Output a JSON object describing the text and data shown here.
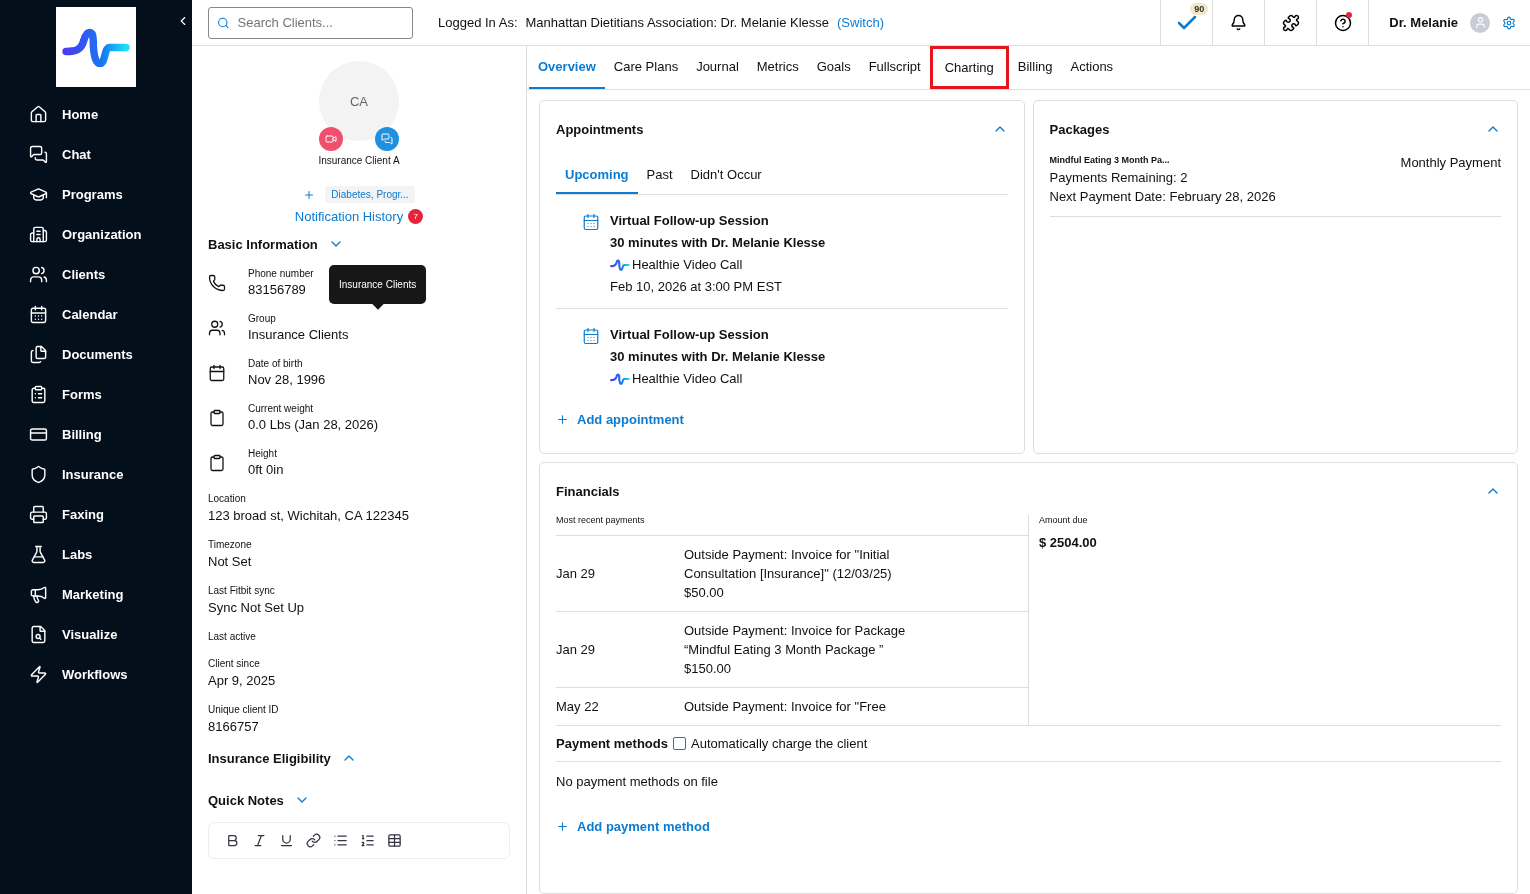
{
  "sidebar": {
    "items": [
      {
        "label": "Home"
      },
      {
        "label": "Chat"
      },
      {
        "label": "Programs"
      },
      {
        "label": "Organization"
      },
      {
        "label": "Clients"
      },
      {
        "label": "Calendar"
      },
      {
        "label": "Documents"
      },
      {
        "label": "Forms"
      },
      {
        "label": "Billing"
      },
      {
        "label": "Insurance"
      },
      {
        "label": "Faxing"
      },
      {
        "label": "Labs"
      },
      {
        "label": "Marketing"
      },
      {
        "label": "Visualize"
      },
      {
        "label": "Workflows"
      }
    ]
  },
  "topbar": {
    "search": {
      "placeholder": "Search Clients..."
    },
    "logged_in_label": "Logged In As:",
    "logged_in_value": "Manhattan Dietitians Association: Dr. Melanie Klesse",
    "switch_link": "(Switch)",
    "tasks_count": "90",
    "help_unread": true,
    "user_name": "Dr. Melanie"
  },
  "client": {
    "initials": "CA",
    "name": "Insurance Client A",
    "tags": "Diabetes, Progr...",
    "notification_history": "Notification History",
    "notification_count": "7",
    "basic_info": {
      "title": "Basic Information",
      "expanded": false
    },
    "icon_fields": [
      {
        "label": "Phone number",
        "value": "83156789"
      },
      {
        "label": "Group",
        "value": "Insurance Clients"
      },
      {
        "label": "Date of birth",
        "value": "Nov 28, 1996"
      },
      {
        "label": "Current weight",
        "value": "0.0 Lbs (Jan 28, 2026)"
      },
      {
        "label": "Height",
        "value": "0ft 0in"
      }
    ],
    "tooltip": "Insurance Clients",
    "fields": [
      {
        "label": "Location",
        "value": "123 broad st, Wichitah, CA 122345"
      },
      {
        "label": "Timezone",
        "value": "Not Set"
      },
      {
        "label": "Last Fitbit sync",
        "value": "Sync Not Set Up"
      },
      {
        "label": "Last active"
      },
      {
        "label": "Client since",
        "value": "Apr 9, 2025"
      },
      {
        "label": "Unique client ID",
        "value": "8166757"
      }
    ],
    "insurance_eligibility": {
      "title": "Insurance Eligibility",
      "expanded": true
    },
    "quick_notes": {
      "title": "Quick Notes",
      "expanded": false
    }
  },
  "tabs": [
    {
      "label": "Overview",
      "selected": true,
      "highlighted": false
    },
    {
      "label": "Care Plans",
      "selected": false,
      "highlighted": false
    },
    {
      "label": "Journal",
      "selected": false,
      "highlighted": false
    },
    {
      "label": "Metrics",
      "selected": false,
      "highlighted": false
    },
    {
      "label": "Goals",
      "selected": false,
      "highlighted": false
    },
    {
      "label": "Fullscript",
      "selected": false,
      "highlighted": false
    },
    {
      "label": "Charting",
      "selected": false,
      "highlighted": true
    },
    {
      "label": "Billing",
      "selected": false,
      "highlighted": false
    },
    {
      "label": "Actions",
      "selected": false,
      "highlighted": false
    }
  ],
  "appointments": {
    "title": "Appointments",
    "expanded": true,
    "tabs": [
      {
        "label": "Upcoming",
        "selected": true
      },
      {
        "label": "Past",
        "selected": false
      },
      {
        "label": "Didn't Occur",
        "selected": false
      }
    ],
    "items": [
      {
        "title": "Virtual Follow-up Session",
        "duration": "30 minutes with Dr. Melanie Klesse",
        "location": "Healthie Video Call",
        "time": "Feb 10, 2026 at 3:00 PM EST"
      },
      {
        "title": "Virtual Follow-up Session",
        "duration": "30 minutes with Dr. Melanie Klesse",
        "location": "Healthie Video Call"
      }
    ],
    "add": "Add appointment"
  },
  "packages": {
    "title": "Packages",
    "expanded": true,
    "name": "Mindful Eating 3 Month Pa...",
    "payment_type": "Monthly Payment",
    "remaining": "Payments Remaining: 2",
    "next_date": "Next Payment Date: February 28, 2026"
  },
  "financials": {
    "title": "Financials",
    "expanded": true,
    "recent_label": "Most recent payments",
    "payments": [
      {
        "date": "Jan 29",
        "description": "Outside Payment: Invoice for \"Initial Consultation [Insurance]\" (12/03/25)",
        "amount": "$50.00"
      },
      {
        "date": "Jan 29",
        "description": "Outside Payment: Invoice for Package “Mindful Eating 3 Month Package ”",
        "amount": "$150.00"
      },
      {
        "date": "May 22",
        "description": "Outside Payment: Invoice for \"Free"
      }
    ],
    "amount_due_label": "Amount due",
    "amount_due": "$ 2504.00",
    "payment_methods_label": "Payment methods",
    "auto_charge": {
      "label": "Automatically charge the client",
      "checked": false
    },
    "no_methods": "No payment methods on file",
    "add_method": "Add payment method"
  }
}
